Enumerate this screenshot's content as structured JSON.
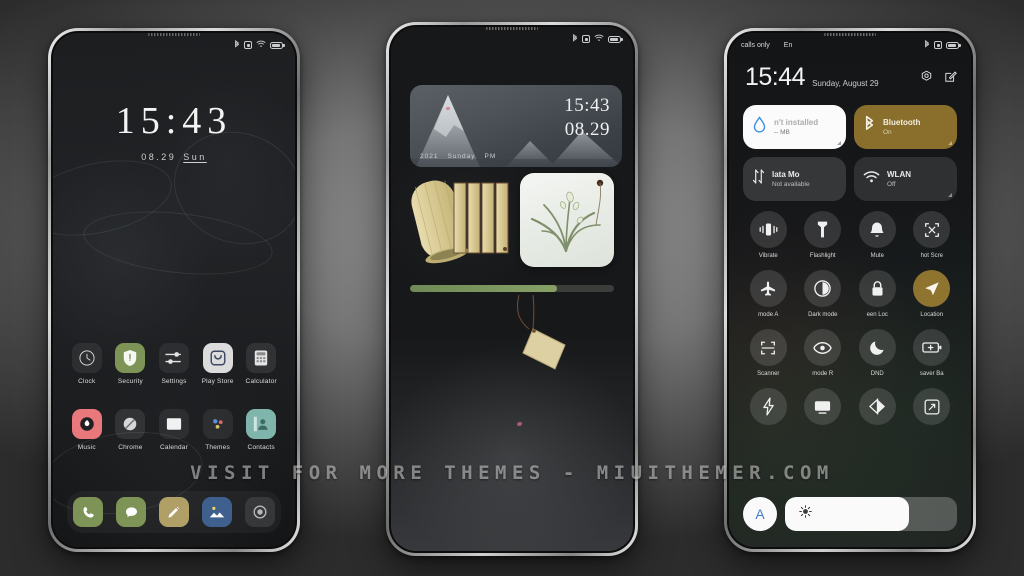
{
  "watermark": "VISIT FOR MORE THEMES - MIUITHEMER.COM",
  "theme": {
    "accent_gold": "#8a6f2c",
    "accent_blue": "#3f7fd0",
    "progress_green": "#87a066",
    "screen_bg": "#17181a"
  },
  "phone_left": {
    "name": "lockscreen",
    "status_bar": {
      "icons": [
        "bluetooth-icon",
        "alarm-icon",
        "wifi-icon",
        "battery-icon"
      ],
      "battery_level": "72"
    },
    "clock": {
      "time": "15:43",
      "date": "08.29",
      "weekday": "Sun"
    },
    "apps_row1": [
      {
        "label": "Clock",
        "icon": "clock-icon"
      },
      {
        "label": "Security",
        "icon": "shield-icon"
      },
      {
        "label": "Settings",
        "icon": "sliders-icon"
      },
      {
        "label": "Play Store",
        "icon": "play-store-icon"
      },
      {
        "label": "Calculator",
        "icon": "calculator-icon"
      }
    ],
    "apps_row2": [
      {
        "label": "Music",
        "icon": "music-icon"
      },
      {
        "label": "Chrome",
        "icon": "chrome-icon"
      },
      {
        "label": "Calendar",
        "icon": "calendar-icon"
      },
      {
        "label": "Themes",
        "icon": "themes-icon"
      },
      {
        "label": "Contacts",
        "icon": "contacts-icon"
      }
    ],
    "dock": [
      {
        "label": "Phone",
        "icon": "phone-icon"
      },
      {
        "label": "Messages",
        "icon": "message-icon"
      },
      {
        "label": "Notes",
        "icon": "pencil-icon"
      },
      {
        "label": "Gallery",
        "icon": "gallery-icon"
      },
      {
        "label": "Camera",
        "icon": "camera-icon"
      }
    ]
  },
  "phone_middle": {
    "name": "home-screen",
    "status_bar": {
      "icons": [
        "bluetooth-icon",
        "alarm-icon",
        "wifi-icon",
        "battery-icon"
      ]
    },
    "clock_widget": {
      "time": "15:43",
      "date": "08.29",
      "year": "2021",
      "weekday": "Sunday",
      "meridiem": "PM"
    },
    "widgets": [
      {
        "name": "bamboo-scroll-widget"
      },
      {
        "name": "orchid-painting-widget"
      }
    ],
    "progress_bar": {
      "value": "72"
    },
    "hanging_tag": {
      "name": "bamboo-tag-decoration"
    }
  },
  "phone_right": {
    "name": "control-center",
    "status_bar": {
      "carrier": "calls only",
      "carrier2": "En",
      "icons": [
        "bluetooth-icon",
        "alarm-icon",
        "battery-icon"
      ]
    },
    "header": {
      "time": "15:44",
      "date": "Sunday, August 29",
      "actions": [
        "settings-icon",
        "edit-icon"
      ]
    },
    "big_tiles": [
      {
        "label": "n't installed",
        "sub": "-- MB",
        "icon": "water-drop-icon",
        "style": "white"
      },
      {
        "label": "Bluetooth",
        "sub": "On",
        "icon": "bluetooth-icon",
        "style": "gold"
      },
      {
        "label": "lata    Mo",
        "sub": "Not available",
        "icon": "data-arrows-icon",
        "style": "grey"
      },
      {
        "label": "WLAN",
        "sub": "Off",
        "icon": "wifi-icon",
        "style": "grey2"
      }
    ],
    "toggles": [
      {
        "label": "Vibrate",
        "icon": "vibrate-icon",
        "active": false
      },
      {
        "label": "Flashlight",
        "icon": "flashlight-icon",
        "active": false
      },
      {
        "label": "Mute",
        "icon": "bell-icon",
        "active": false
      },
      {
        "label": "hot    Scre",
        "icon": "screenshot-icon",
        "active": false
      },
      {
        "label": "mode    A",
        "icon": "airplane-icon",
        "active": false
      },
      {
        "label": "Dark mode",
        "icon": "contrast-icon",
        "active": false
      },
      {
        "label": "een    Loc",
        "icon": "lock-icon",
        "active": false
      },
      {
        "label": "Location",
        "icon": "location-icon",
        "active": true
      },
      {
        "label": "Scanner",
        "icon": "scanner-icon",
        "active": false
      },
      {
        "label": "mode    R",
        "icon": "eye-icon",
        "active": false
      },
      {
        "label": "DND",
        "icon": "moon-icon",
        "active": false
      },
      {
        "label": "saver    Ba",
        "icon": "battery-saver-icon",
        "active": false
      },
      {
        "label": "",
        "icon": "bolt-icon",
        "active": false
      },
      {
        "label": "",
        "icon": "cast-icon",
        "active": false
      },
      {
        "label": "",
        "icon": "half-contrast-icon",
        "active": false
      },
      {
        "label": "",
        "icon": "resize-icon",
        "active": false
      }
    ],
    "brightness": {
      "auto_label": "A",
      "value": "72",
      "icon": "sun-icon"
    }
  }
}
